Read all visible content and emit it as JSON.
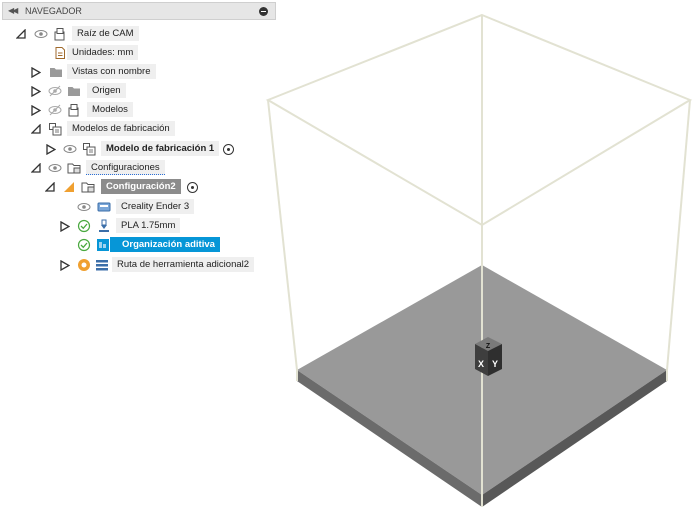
{
  "browser": {
    "title": "NAVEGADOR",
    "items": [
      {
        "label": "Raíz de CAM"
      },
      {
        "label": "Unidades: mm"
      },
      {
        "label": "Vistas con nombre"
      },
      {
        "label": "Origen"
      },
      {
        "label": "Modelos"
      },
      {
        "label": "Modelos de fabricación"
      },
      {
        "label": "Modelo de fabricación 1"
      },
      {
        "label": "Configuraciones"
      },
      {
        "label": "Configuración2"
      },
      {
        "label": "Creality Ender 3"
      },
      {
        "label": "PLA 1.75mm"
      },
      {
        "label": "Organización aditiva"
      },
      {
        "label": "Ruta de herramienta adicional2"
      }
    ]
  },
  "viewcube": {
    "top": "Z",
    "left": "X",
    "right": "Y"
  },
  "colors": {
    "selection": "#0696d7",
    "plate": "#999999",
    "frame": "#e2e2d2",
    "check": "#49a83e",
    "warning": "#f0a030"
  }
}
